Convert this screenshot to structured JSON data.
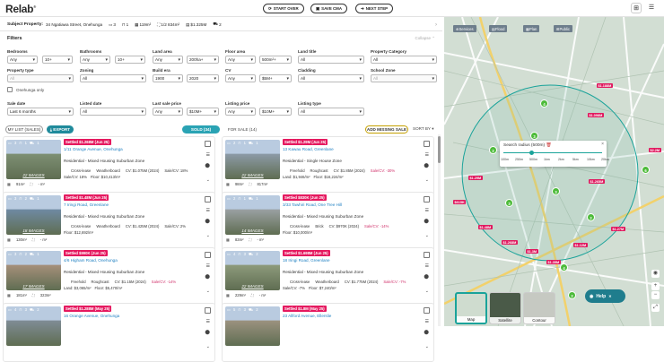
{
  "app": {
    "logo": "Relab",
    "logo_mark": "®"
  },
  "toolbar": {
    "start_over": "START OVER",
    "save_cma": "SAVE CMA",
    "next_step": "NEXT STEP"
  },
  "subject": {
    "label": "Subject Property:",
    "address": "34 Ngatiawa Street, Onehunga",
    "beds": "3",
    "baths": "1",
    "floor": "119m²",
    "land": "1/2 834m²",
    "cv": "$1.325M",
    "parking": "2"
  },
  "filters": {
    "title": "Filters",
    "collapse": "Collapse",
    "bedrooms": {
      "label": "Bedrooms",
      "min": "Any",
      "max": "10+"
    },
    "bathrooms": {
      "label": "Bathrooms",
      "min": "Any",
      "max": "10+"
    },
    "land_area": {
      "label": "Land area",
      "min": "Any",
      "max": "200ha+"
    },
    "floor_area": {
      "label": "Floor area",
      "min": "Any",
      "max": "500m²+"
    },
    "land_title": {
      "label": "Land title",
      "value": "All"
    },
    "property_category": {
      "label": "Property Category",
      "value": "All"
    },
    "property_type": {
      "label": "Property type",
      "value": "All"
    },
    "zoning": {
      "label": "Zoning",
      "value": "All"
    },
    "build_era": {
      "label": "Build era",
      "min": "1900",
      "max": "2020"
    },
    "cv": {
      "label": "CV",
      "min": "Any",
      "max": "$5M+"
    },
    "cladding": {
      "label": "Cladding",
      "value": "All"
    },
    "school_zone": {
      "label": "School Zone",
      "value": "All"
    },
    "onehunga_only": "Onehunga only",
    "sale_date": {
      "label": "Sale date",
      "value": "Last 6 months"
    },
    "listed_date": {
      "label": "Listed date",
      "value": "All"
    },
    "last_sale_price": {
      "label": "Last sale price",
      "min": "Any",
      "max": "$10M+"
    },
    "listing_price": {
      "label": "Listing price",
      "min": "Any",
      "max": "$10M+"
    },
    "listing_type": {
      "label": "Listing type",
      "value": "All"
    }
  },
  "listbar": {
    "my_list": "MY LIST (SALES)",
    "export": "EXPORT",
    "sold": "SOLD (34)",
    "for_sale": "FOR SALE (14)",
    "add_missing": "ADD MISSING SALE",
    "sort_by": "SORT BY"
  },
  "cards": [
    {
      "tag": "Settled $1.268M (Jun 25)",
      "address": "1/11 Orange Avenue, Onehunga",
      "zone": "Residential - Mixed Housing Suburban Zone",
      "tags": [
        "Cross-lease",
        "Weatherboard",
        "CV: $1.075M (2024)",
        "Sale/CV: 18%"
      ],
      "nums": [
        "Sale/CV: 18%",
        "Floor: $10,413/m²"
      ],
      "images": "22 IMAGES",
      "beds": "3",
      "baths": "1",
      "park": "1",
      "floor": "91m²",
      "land": "- m²"
    },
    {
      "tag": "Settled $1.29M (Jun 25)",
      "address": "13 Kawau Road, Greenlane",
      "zone": "Residential - Single House Zone",
      "tags": [
        "Freehold",
        "Roughcast",
        "CV: $1.85M (2024)",
        "Sale/CV: -30%"
      ],
      "nums": [
        "Land: $1,946/m²",
        "Floor: $16,224/m²"
      ],
      "images": "22 IMAGES",
      "beds": "2",
      "baths": "1",
      "park": "1",
      "floor": "98m²",
      "land": "817m²"
    },
    {
      "tag": "Settled $1.48M (Jun 25)",
      "address": "7 Iringi Road, Greenlane",
      "zone": "Residential - Mixed Housing Suburban Zone",
      "tags": [
        "Cross-lease",
        "Weatherboard",
        "CV: $1.425M (2024)",
        "Sale/CV: 2%"
      ],
      "nums": [
        "Floor: $12,692/m²"
      ],
      "images": "18 IMAGES",
      "beds": "3",
      "baths": "2",
      "park": "1",
      "floor": "130m²",
      "land": "- m²"
    },
    {
      "tag": "Settled $830K (Jun 25)",
      "address": "3/33 Tawhiri Road, One Tree Hill",
      "zone": "Residential - Mixed Housing Suburban Zone",
      "tags": [
        "Cross-lease",
        "Brick",
        "CV: $970K (2024)",
        "Sale/CV: -14%"
      ],
      "nums": [
        "Floor: $10,000/m²"
      ],
      "images": "14 IMAGES",
      "beds": "2",
      "baths": "1",
      "park": "1",
      "floor": "83m²",
      "land": "- m²"
    },
    {
      "tag": "Settled $990K (Jun 25)",
      "address": "4/6 Higham Road, Onehunga",
      "zone": "Residential - Mixed Housing Suburban Zone",
      "tags": [
        "Freehold",
        "Roughcast",
        "CV: $1.15M (2024)",
        "Sale/CV: -14%"
      ],
      "nums": [
        "Land: $3,065/m²",
        "Floor: $5,470/m²"
      ],
      "images": "17 IMAGES",
      "beds": "3",
      "baths": "2",
      "park": "1",
      "floor": "181m²",
      "land": "323m²"
    },
    {
      "tag": "Settled $1.698M (Jun 25)",
      "address": "18 Iringi Road, Greenlane",
      "zone": "Residential - Mixed Housing Suburban Zone",
      "tags": [
        "Cross-lease",
        "Weatherboard",
        "CV: $1.775M (2024)",
        "Sale/CV: -7%"
      ],
      "nums": [
        "Sale/CV: -7%",
        "Floor: $7,240/m²"
      ],
      "images": "22 IMAGES",
      "beds": "4",
      "baths": "3",
      "park": "2",
      "floor": "229m²",
      "land": "- m²"
    },
    {
      "tag": "Settled $1.288M (May 25)",
      "address": "16 Orange Avenue, Onehunga",
      "zone": "",
      "tags": [],
      "nums": [],
      "images": "",
      "beds": "4",
      "baths": "3",
      "park": "2",
      "floor": "",
      "land": ""
    },
    {
      "tag": "Settled $1.8M (May 25)",
      "address": "23 Allford Avenue, Ellerslie",
      "zone": "",
      "tags": [],
      "nums": [],
      "images": "",
      "beds": "5",
      "baths": "3",
      "park": "2",
      "floor": "",
      "land": ""
    }
  ],
  "map": {
    "buttons": [
      "Services",
      "Flood",
      "Plan",
      "Public"
    ],
    "prices": [
      "$1.188M",
      "$1.098M",
      "$2.2M",
      "$1.29M",
      "$1.265M",
      "$1.3M",
      "$1.48M",
      "$1.268M",
      "$1.12M",
      "$1.27M",
      "$1.35M",
      "$615K"
    ],
    "clusters": [
      "4",
      "2",
      "6",
      "3",
      "3",
      "2",
      "4",
      "2",
      "3"
    ],
    "popup": {
      "title": "Search radius (500m)",
      "ticks": [
        "100m",
        "250m",
        "500m",
        "1km",
        "2km",
        "5km",
        "10km",
        "20km"
      ],
      "value_m": 500
    },
    "types": [
      "Map",
      "Satellite",
      "Contour"
    ],
    "help": "Help"
  }
}
